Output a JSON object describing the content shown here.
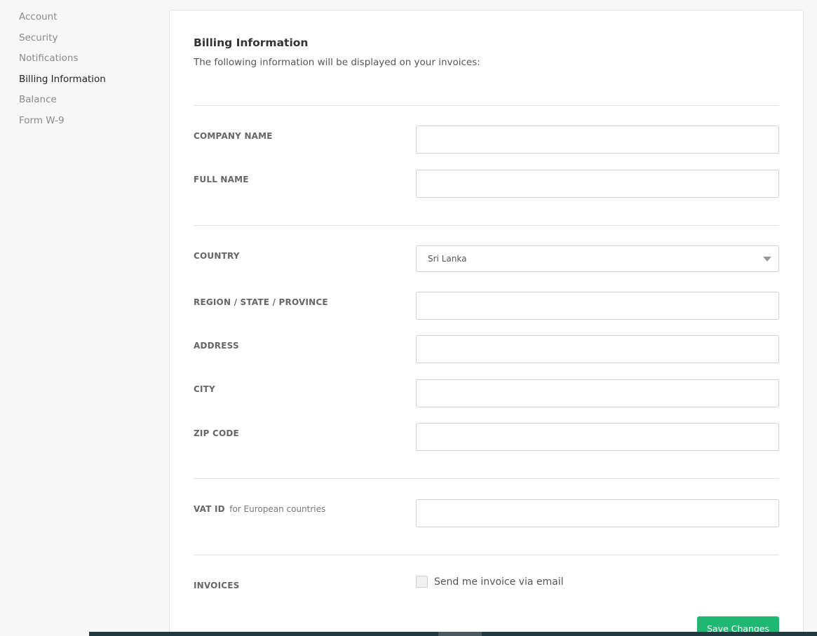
{
  "sidebar": {
    "items": [
      {
        "label": "Account",
        "active": false
      },
      {
        "label": "Security",
        "active": false
      },
      {
        "label": "Notifications",
        "active": false
      },
      {
        "label": "Billing Information",
        "active": true
      },
      {
        "label": "Balance",
        "active": false
      },
      {
        "label": "Form W-9",
        "active": false
      }
    ]
  },
  "billing": {
    "title": "Billing Information",
    "subtitle": "The following information will be displayed on your invoices:",
    "fields": {
      "company_name": {
        "label": "COMPANY NAME",
        "value": ""
      },
      "full_name": {
        "label": "FULL NAME",
        "value": ""
      },
      "country": {
        "label": "COUNTRY",
        "value": "Sri Lanka"
      },
      "region": {
        "label": "REGION / STATE / PROVINCE",
        "value": ""
      },
      "address": {
        "label": "ADDRESS",
        "value": ""
      },
      "city": {
        "label": "CITY",
        "value": ""
      },
      "zip": {
        "label": "ZIP CODE",
        "value": ""
      },
      "vat": {
        "label": "VAT ID",
        "note": "for European countries",
        "value": ""
      }
    },
    "invoices": {
      "label": "INVOICES",
      "checkbox_label": "Send me invoice via email",
      "checked": false
    },
    "save_label": "Save Changes"
  },
  "colors": {
    "accent": "#1fb873",
    "background": "#f7f7f7",
    "panel": "#ffffff"
  }
}
